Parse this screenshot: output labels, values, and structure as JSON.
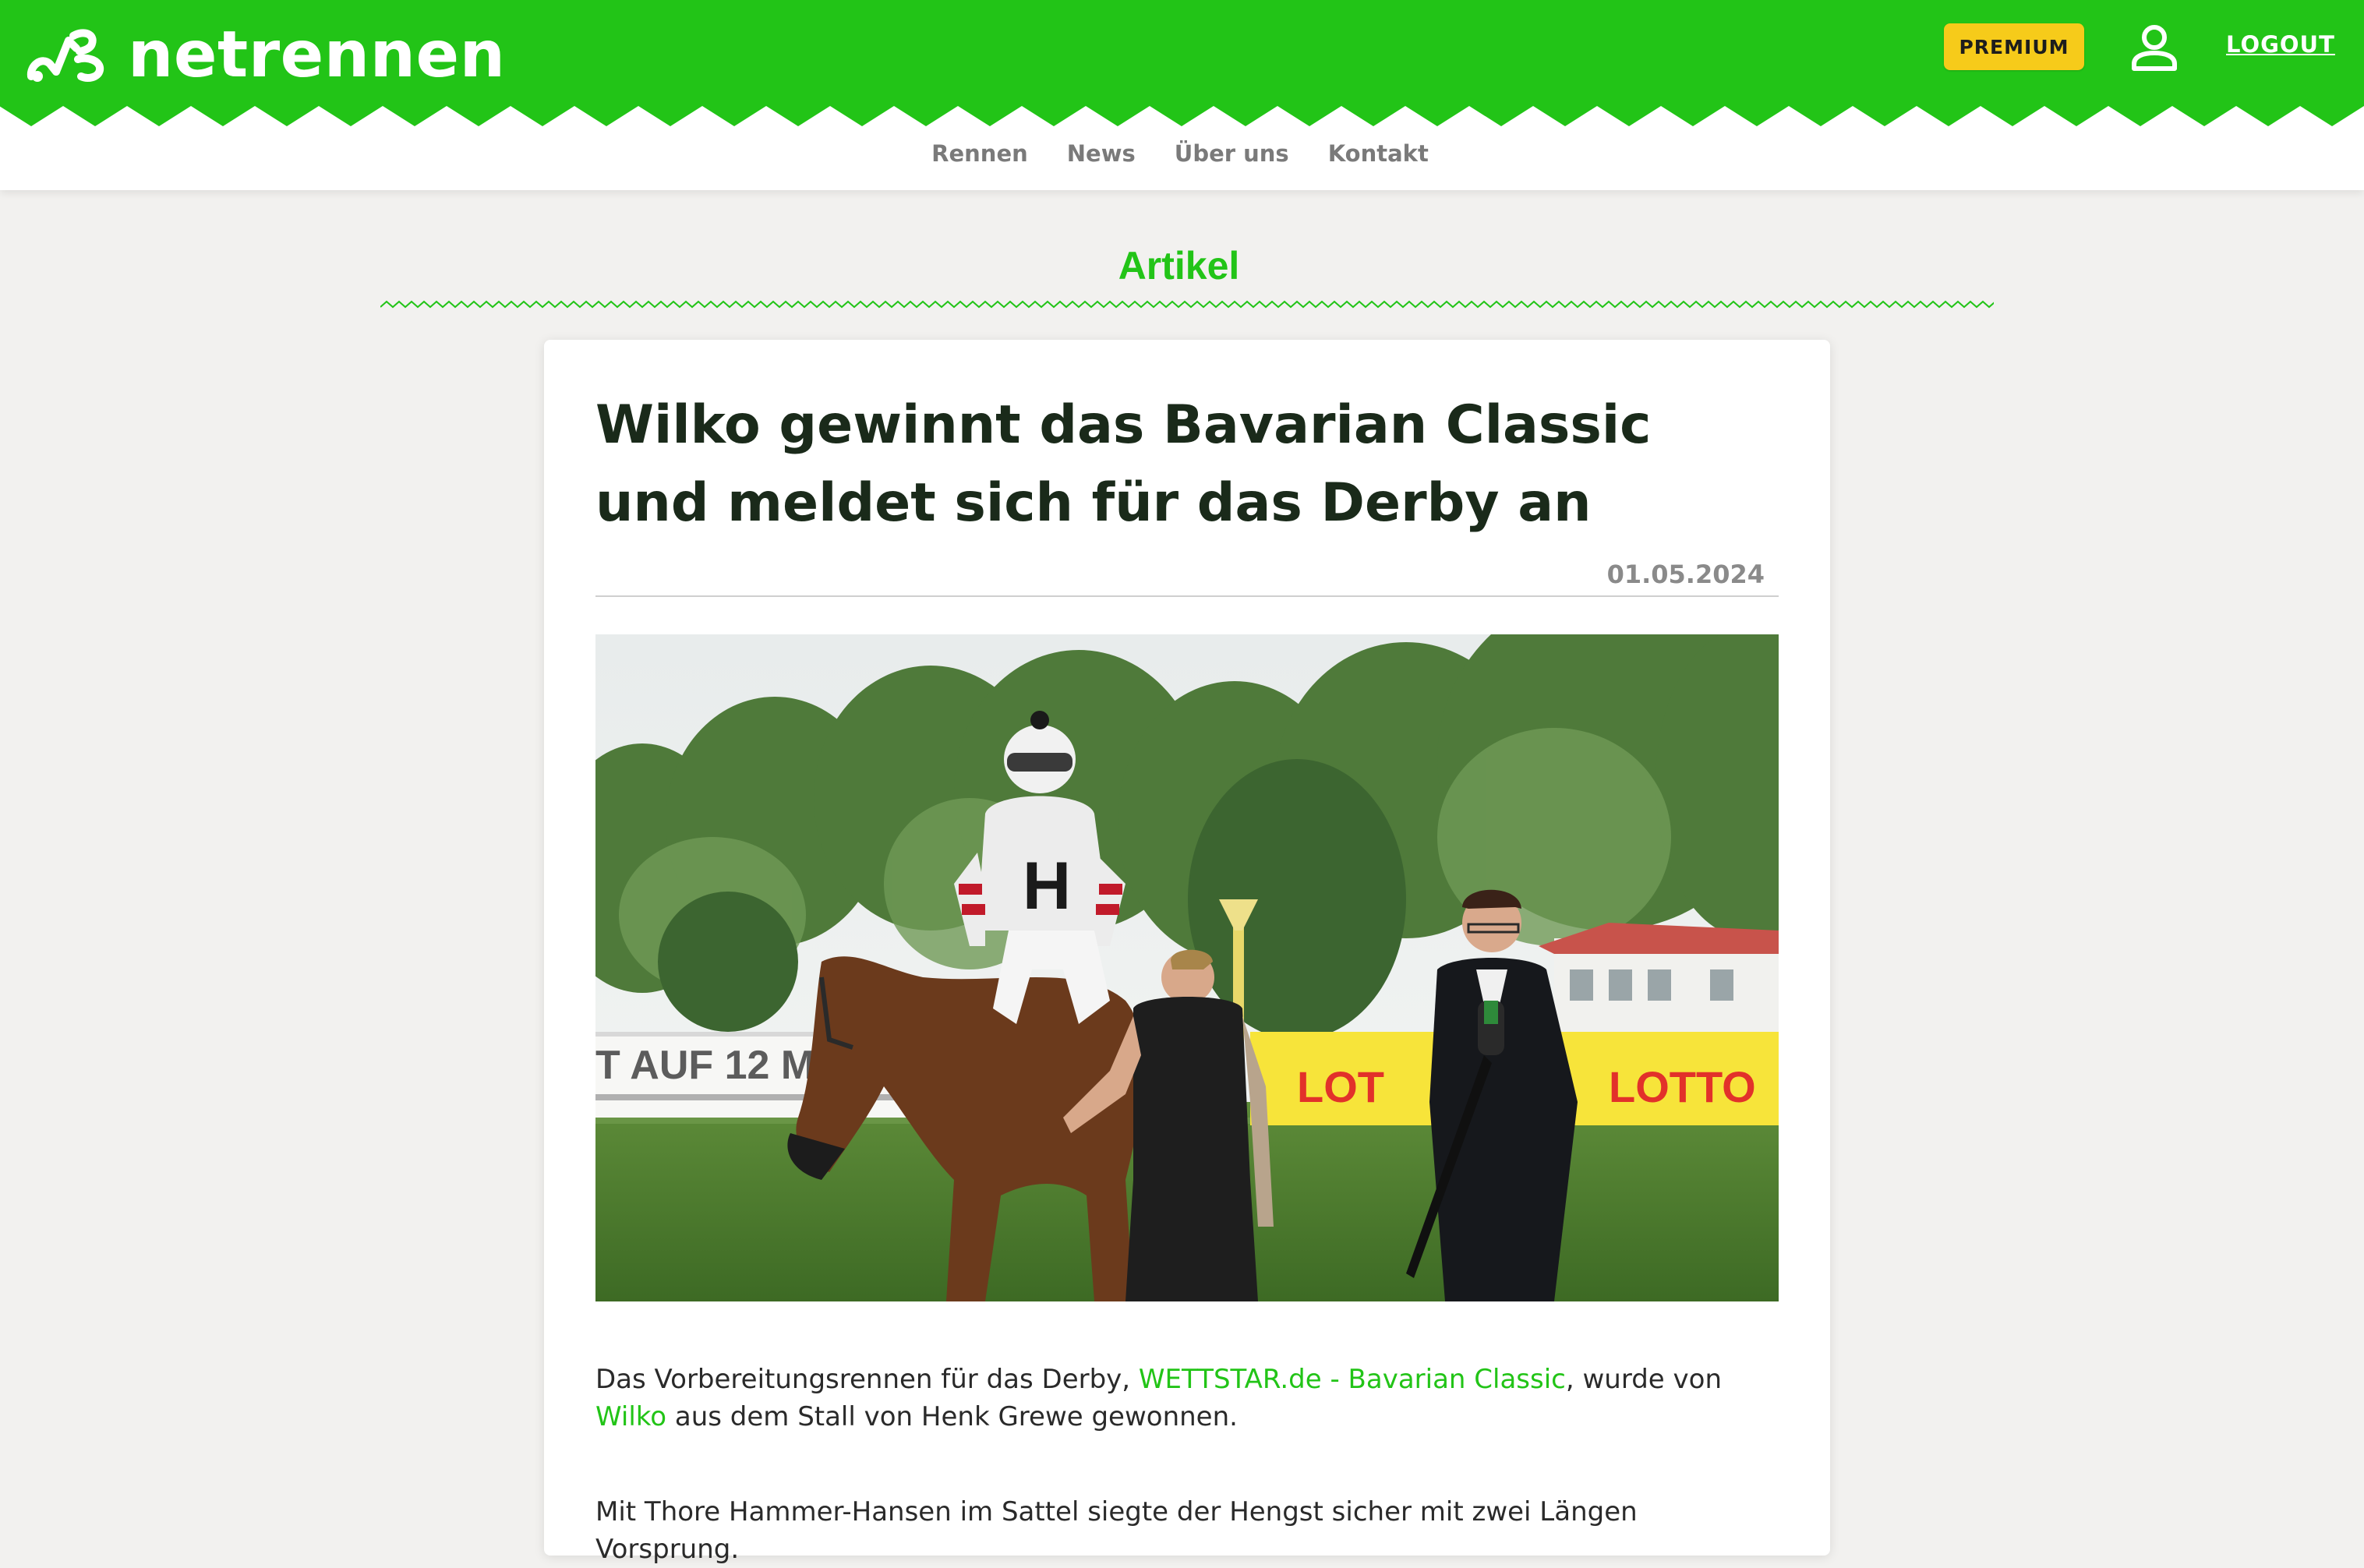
{
  "header": {
    "logo_text": "netrennen",
    "premium_label": "PREMIUM",
    "logout_label": "LOGOUT",
    "brand_green": "#22c417",
    "premium_color": "#f6cb1a"
  },
  "nav": {
    "items": [
      {
        "label": "Rennen"
      },
      {
        "label": "News"
      },
      {
        "label": "Über uns"
      },
      {
        "label": "Kontakt"
      }
    ]
  },
  "section": {
    "title": "Artikel"
  },
  "article": {
    "title": "Wilko gewinnt das Bavarian Classic und meldet sich für das Derby an",
    "date": "01.05.2024",
    "paragraph1": {
      "before": "Das Vorbereitungsrennen für das Derby, ",
      "link1": "WETTSTAR.de - Bavarian Classic",
      "middle": ", wurde von ",
      "link2": "Wilko",
      "after": " aus dem Stall von Henk Grewe gewonnen."
    },
    "paragraph2": {
      "text": "Mit Thore Hammer-Hansen im Sattel siegte der Hengst sicher mit zwei Längen Vorsprung."
    },
    "image": {
      "banner_left_text": "T AUF 12 ME",
      "banner_right_text": "LOTTO",
      "banner_mid_text": "LOT",
      "jockey_letter": "H"
    }
  },
  "icons": {
    "logo": "horse-track-logo-icon",
    "user": "user-icon"
  }
}
